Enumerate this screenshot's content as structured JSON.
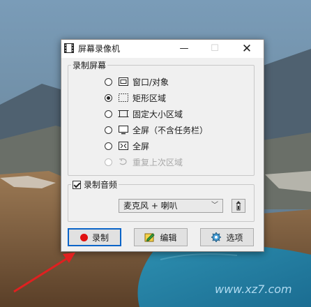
{
  "window": {
    "title": "屏幕录像机",
    "min_glyph": "—",
    "max_glyph": "☐",
    "close_glyph": "✕"
  },
  "record_screen_group": {
    "label": "录制屏幕",
    "options": [
      {
        "label": "窗口/对象",
        "icon": "window-icon",
        "selected": false,
        "disabled": false
      },
      {
        "label": "矩形区域",
        "icon": "dotted-rectangle-icon",
        "selected": true,
        "disabled": false
      },
      {
        "label": "固定大小区域",
        "icon": "fixed-size-icon",
        "selected": false,
        "disabled": false
      },
      {
        "label": "全屏（不含任务栏）",
        "icon": "monitor-icon",
        "selected": false,
        "disabled": false
      },
      {
        "label": "全屏",
        "icon": "fullscreen-icon",
        "selected": false,
        "disabled": false
      },
      {
        "label": "重复上次区域",
        "icon": "repeat-icon",
        "selected": false,
        "disabled": true
      }
    ]
  },
  "record_audio_group": {
    "label": "录制音频",
    "checked": true,
    "source_value": "麦克风 + 喇叭",
    "chevron": "﹀"
  },
  "buttons": {
    "record": "录制",
    "edit": "编辑",
    "options": "选项"
  },
  "colors": {
    "accent": "#0a64c8",
    "record_dot": "#e01010",
    "arrow": "#e02020"
  },
  "watermark": "www.xz7.com"
}
